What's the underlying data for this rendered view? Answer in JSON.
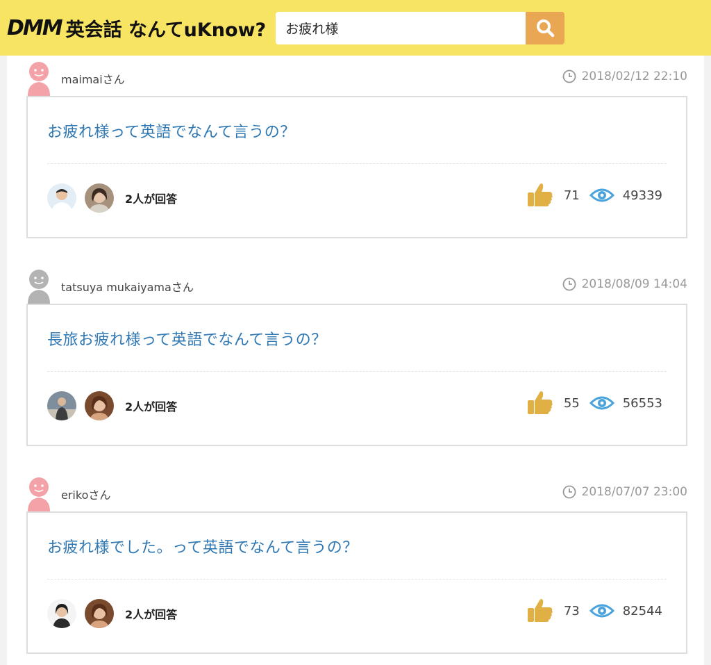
{
  "header": {
    "logo_brand": "DMM",
    "logo_name": "英会話 なんてuKnow?",
    "search_value": "お疲れ様"
  },
  "questions": [
    {
      "username": "maimaiさん",
      "avatar_color": "#f3a3a8",
      "timestamp": "2018/02/12 22:10",
      "title": "お疲れ様って英語でなんて言うの？",
      "answer_count": "2人が回答",
      "likes": "71",
      "views": "49339"
    },
    {
      "username": "tatsuya mukaiyamaさん",
      "avatar_color": "#b3b3b3",
      "timestamp": "2018/08/09 14:04",
      "title": "長旅お疲れ様って英語でなんて言うの？",
      "answer_count": "2人が回答",
      "likes": "55",
      "views": "56553"
    },
    {
      "username": "erikoさん",
      "avatar_color": "#f3a3a8",
      "timestamp": "2018/07/07 23:00",
      "title": "お疲れ様でした。って英語でなんて言うの？",
      "answer_count": "2人が回答",
      "likes": "73",
      "views": "82544"
    }
  ],
  "colors": {
    "header_bg": "#f7e463",
    "search_button": "#e9a653",
    "title_link": "#2f78b3",
    "thumb": "#e0b045",
    "eye": "#4aa3dc"
  },
  "icons": {
    "search": "search-icon",
    "clock": "clock-icon",
    "like": "thumbs-up-icon",
    "views": "eye-icon"
  }
}
